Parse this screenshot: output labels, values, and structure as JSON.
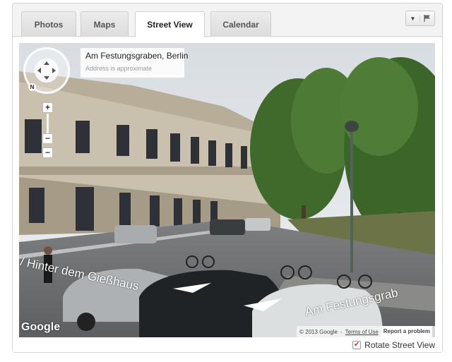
{
  "tabs": [
    {
      "label": "Photos"
    },
    {
      "label": "Maps"
    },
    {
      "label": "Street View"
    },
    {
      "label": "Calendar"
    }
  ],
  "active_tab": "Street View",
  "toolbar": {
    "caret_glyph": "▼",
    "flag_icon": "flag-icon"
  },
  "streetview": {
    "address": "Am Festungsgraben, Berlin",
    "address_note": "Address is approximate",
    "compass_north": "N",
    "zoom_in": "+",
    "zoom_out": "−",
    "street_label_left": "/ Hinter dem Gießhaus",
    "street_label_right": "Am Festungsgrab",
    "google_logo": "Google",
    "copyright": "© 2013 Google",
    "terms": "Terms of Use",
    "report": "Report a problem"
  },
  "rotate_option": {
    "label": "Rotate Street View",
    "checked": true,
    "check_glyph": "✔"
  }
}
